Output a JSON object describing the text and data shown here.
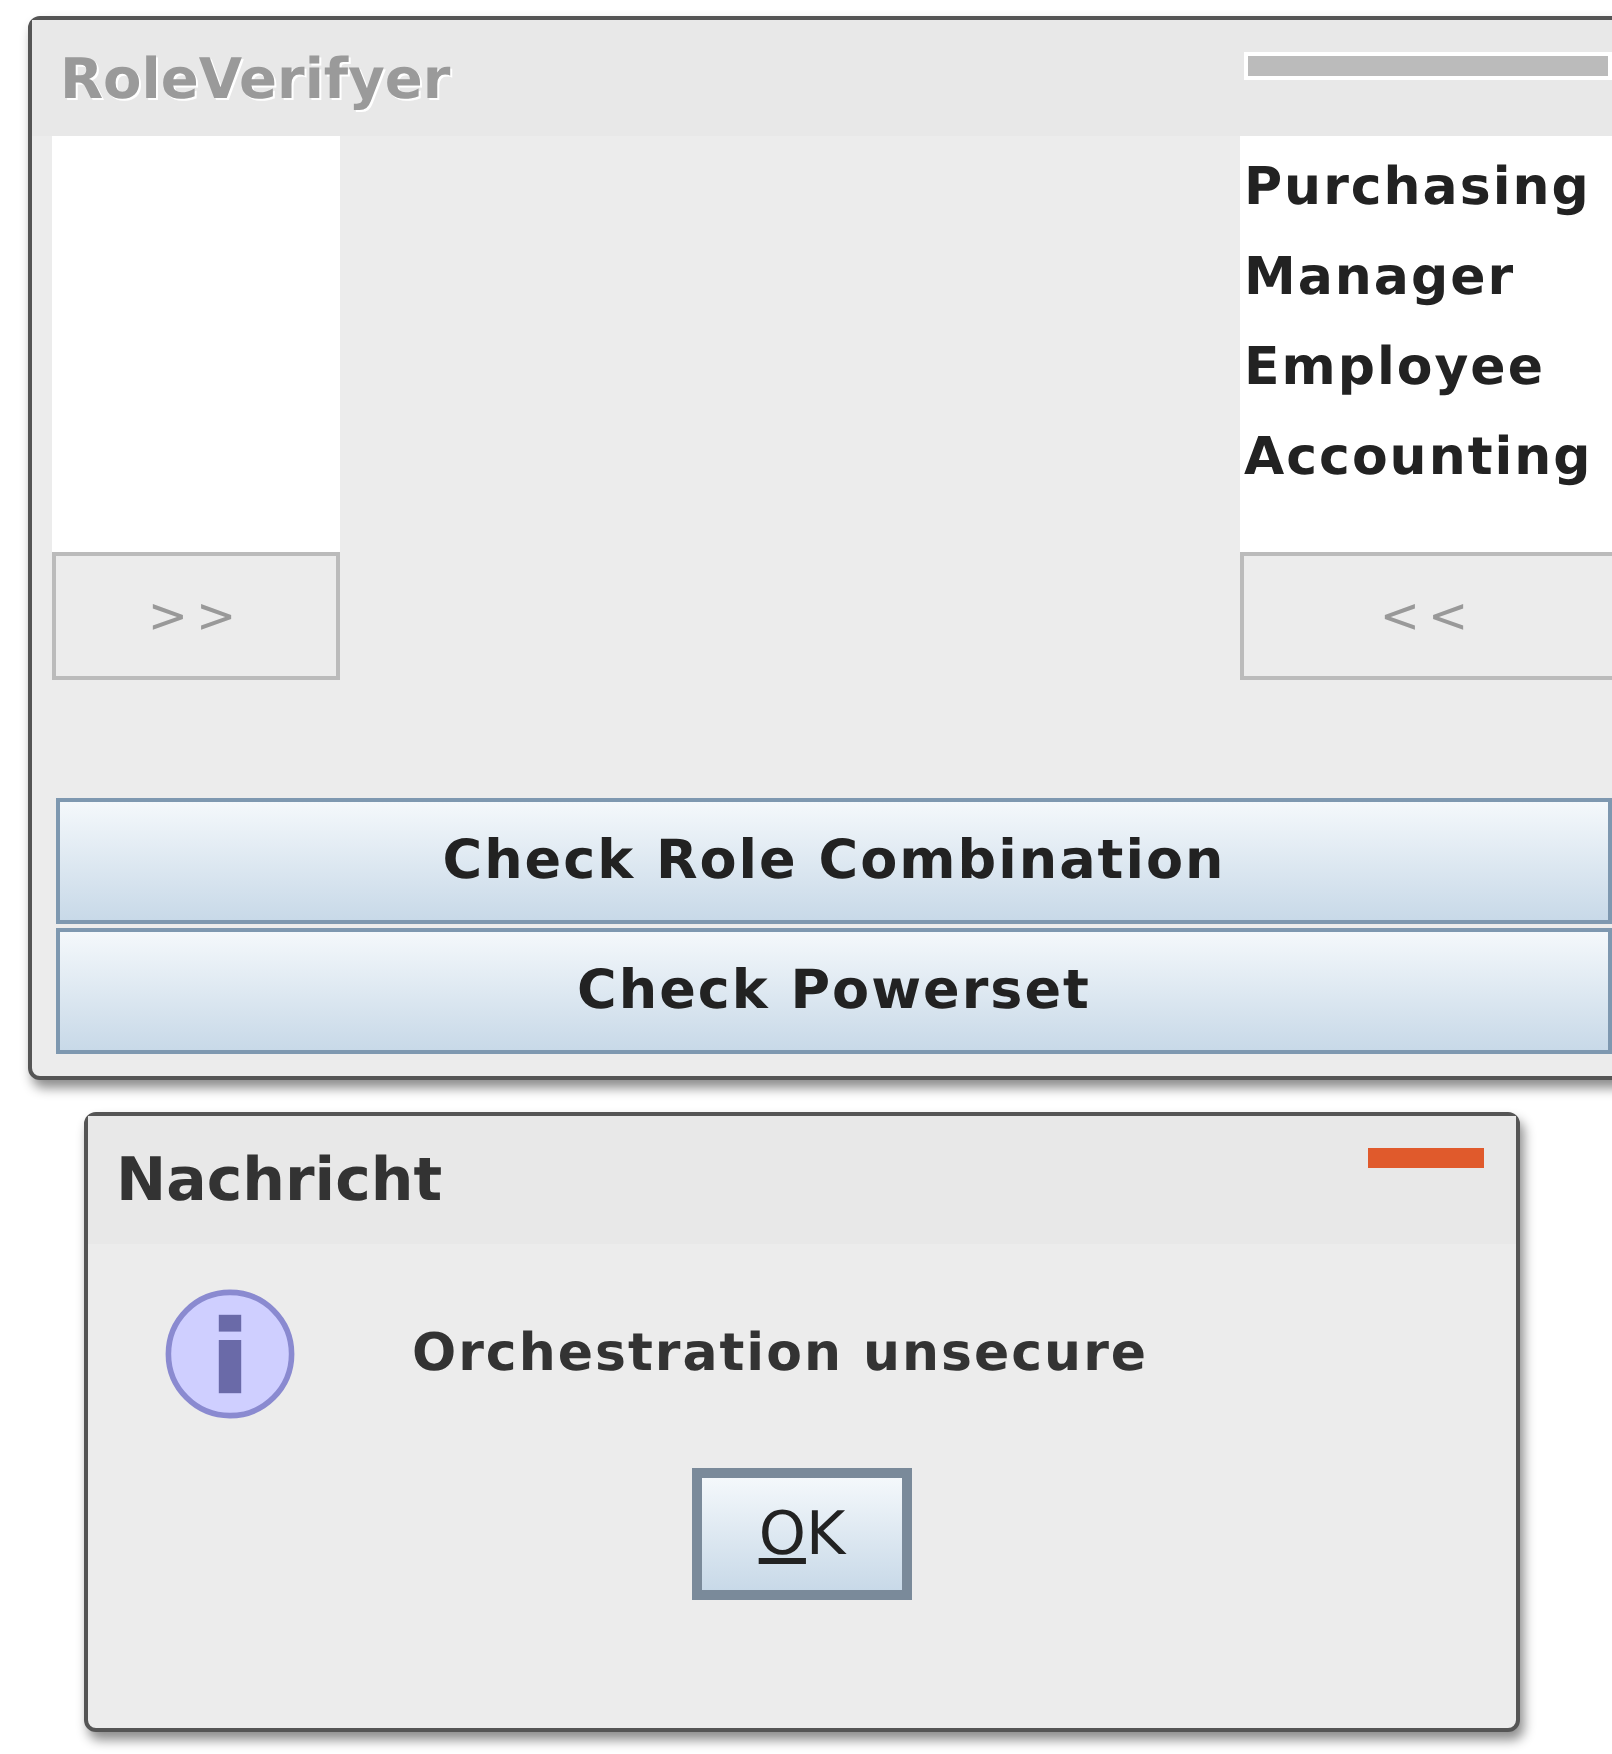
{
  "main_window": {
    "title": "RoleVerifyer",
    "active": false,
    "add_button": ">>",
    "right_list": {
      "items": [
        "Purchasing",
        "Manager",
        "Employee",
        "Accounting"
      ]
    },
    "remove_button": "<<",
    "buttons": [
      "Check Role Combination",
      "Check Powerset"
    ]
  },
  "dialog": {
    "title": "Nachricht",
    "active": true,
    "message": "Orchestration unsecure",
    "button": {
      "label": "OK",
      "mnemonic_underlined": true
    }
  }
}
